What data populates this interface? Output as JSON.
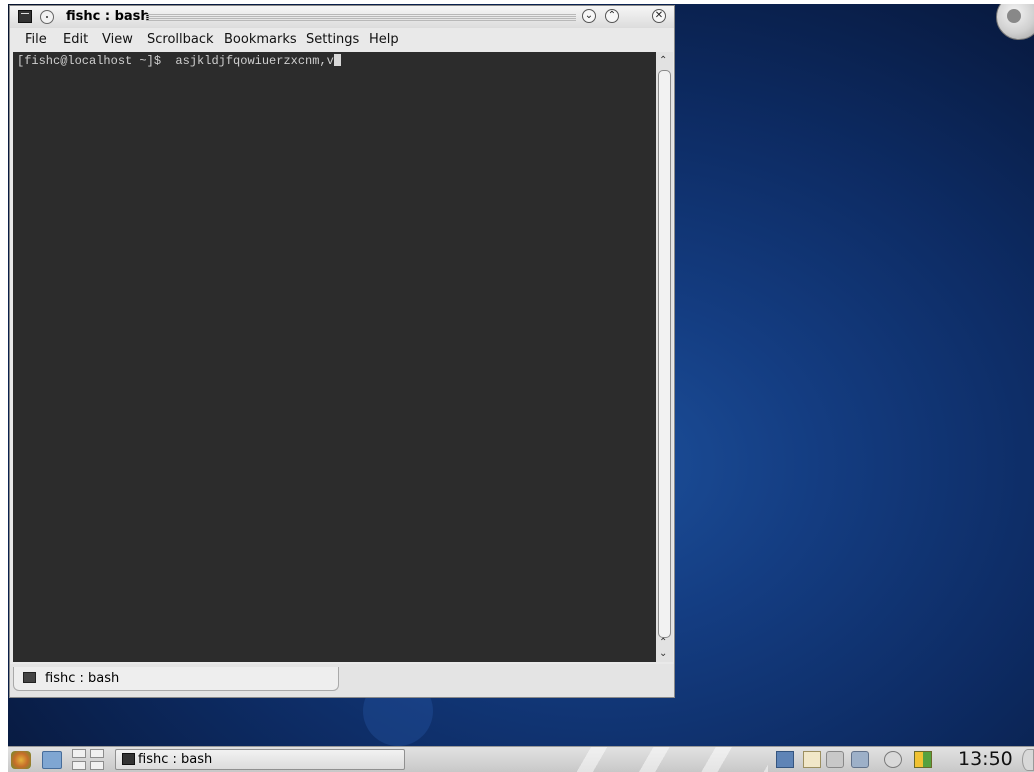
{
  "window": {
    "title": "fishc : bash"
  },
  "menubar": {
    "items": [
      "File",
      "Edit",
      "View",
      "Scrollback",
      "Bookmarks",
      "Settings",
      "Help"
    ]
  },
  "terminal": {
    "prompt": "[fishc@localhost ~]$ ",
    "command": " asjkldjfqowiuerzxcnm,v"
  },
  "tabs": [
    {
      "label": "fishc : bash"
    }
  ],
  "taskbar": {
    "task_label": "fishc : bash",
    "clock": "13:50"
  },
  "icons": {
    "terminal": "terminal-icon",
    "pin": "pin-icon",
    "minimize": "minimize-icon",
    "maximize": "maximize-icon",
    "close": "close-icon"
  }
}
